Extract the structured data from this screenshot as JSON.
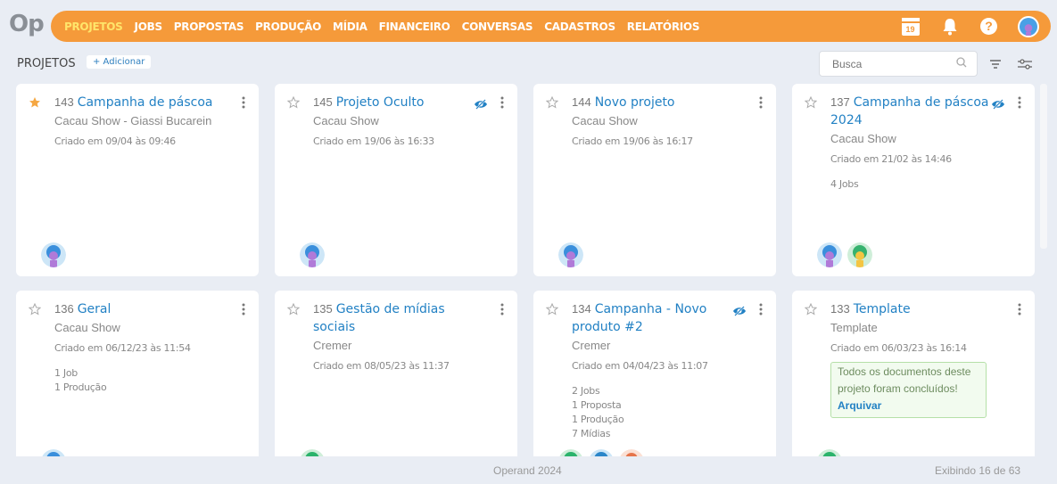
{
  "logo": "Op",
  "nav": {
    "items": [
      "PROJETOS",
      "JOBS",
      "PROPOSTAS",
      "PRODUÇÃO",
      "MÍDIA",
      "FINANCEIRO",
      "CONVERSAS",
      "CADASTROS",
      "RELATÓRIOS"
    ],
    "calendar_day": "19"
  },
  "toolbar": {
    "title": "PROJETOS",
    "add_label": "+ Adicionar",
    "search_placeholder": "Busca"
  },
  "cards": [
    {
      "id": "143",
      "name": "Campanha de páscoa",
      "client": "Cacau Show - Giassi Bucarein",
      "created": "Criado em 09/04 às 09:46",
      "starred": true,
      "hidden": false,
      "stats": [],
      "notice": null
    },
    {
      "id": "145",
      "name": "Projeto Oculto",
      "client": "Cacau Show",
      "created": "Criado em 19/06 às 16:33",
      "starred": false,
      "hidden": true,
      "stats": [],
      "notice": null
    },
    {
      "id": "144",
      "name": "Novo projeto",
      "client": "Cacau Show",
      "created": "Criado em 19/06 às 16:17",
      "starred": false,
      "hidden": false,
      "stats": [],
      "notice": null
    },
    {
      "id": "137",
      "name": "Campanha de páscoa 2024",
      "client": "Cacau Show",
      "created": "Criado em 21/02 às 14:46",
      "starred": false,
      "hidden": true,
      "stats": [
        "4 Jobs"
      ],
      "notice": null
    },
    {
      "id": "136",
      "name": "Geral",
      "client": "Cacau Show",
      "created": "Criado em 06/12/23 às 11:54",
      "starred": false,
      "hidden": false,
      "stats": [
        "1 Job",
        "1 Produção"
      ],
      "notice": null
    },
    {
      "id": "135",
      "name": "Gestão de mídias sociais",
      "client": "Cremer",
      "created": "Criado em 08/05/23 às 11:37",
      "starred": false,
      "hidden": false,
      "stats": [],
      "notice": null
    },
    {
      "id": "134",
      "name": "Campanha - Novo produto #2",
      "client": "Cremer",
      "created": "Criado em 04/04/23 às 11:07",
      "starred": false,
      "hidden": true,
      "stats": [
        "2 Jobs",
        "1 Proposta",
        "1 Produção",
        "7 Mídias"
      ],
      "notice": null
    },
    {
      "id": "133",
      "name": "Template",
      "client": "Template",
      "created": "Criado em 06/03/23 às 16:14",
      "starred": false,
      "hidden": false,
      "stats": [],
      "notice": {
        "text": "Todos os documentos deste projeto foram concluídos!",
        "link": "Arquivar"
      }
    }
  ],
  "footer": {
    "center": "Operand 2024",
    "right": "Exibindo 16 de 63"
  },
  "colors": {
    "accent": "#f59a3a",
    "active_nav": "#ffe56a",
    "link": "#2281c4",
    "star": "#f5a742"
  }
}
